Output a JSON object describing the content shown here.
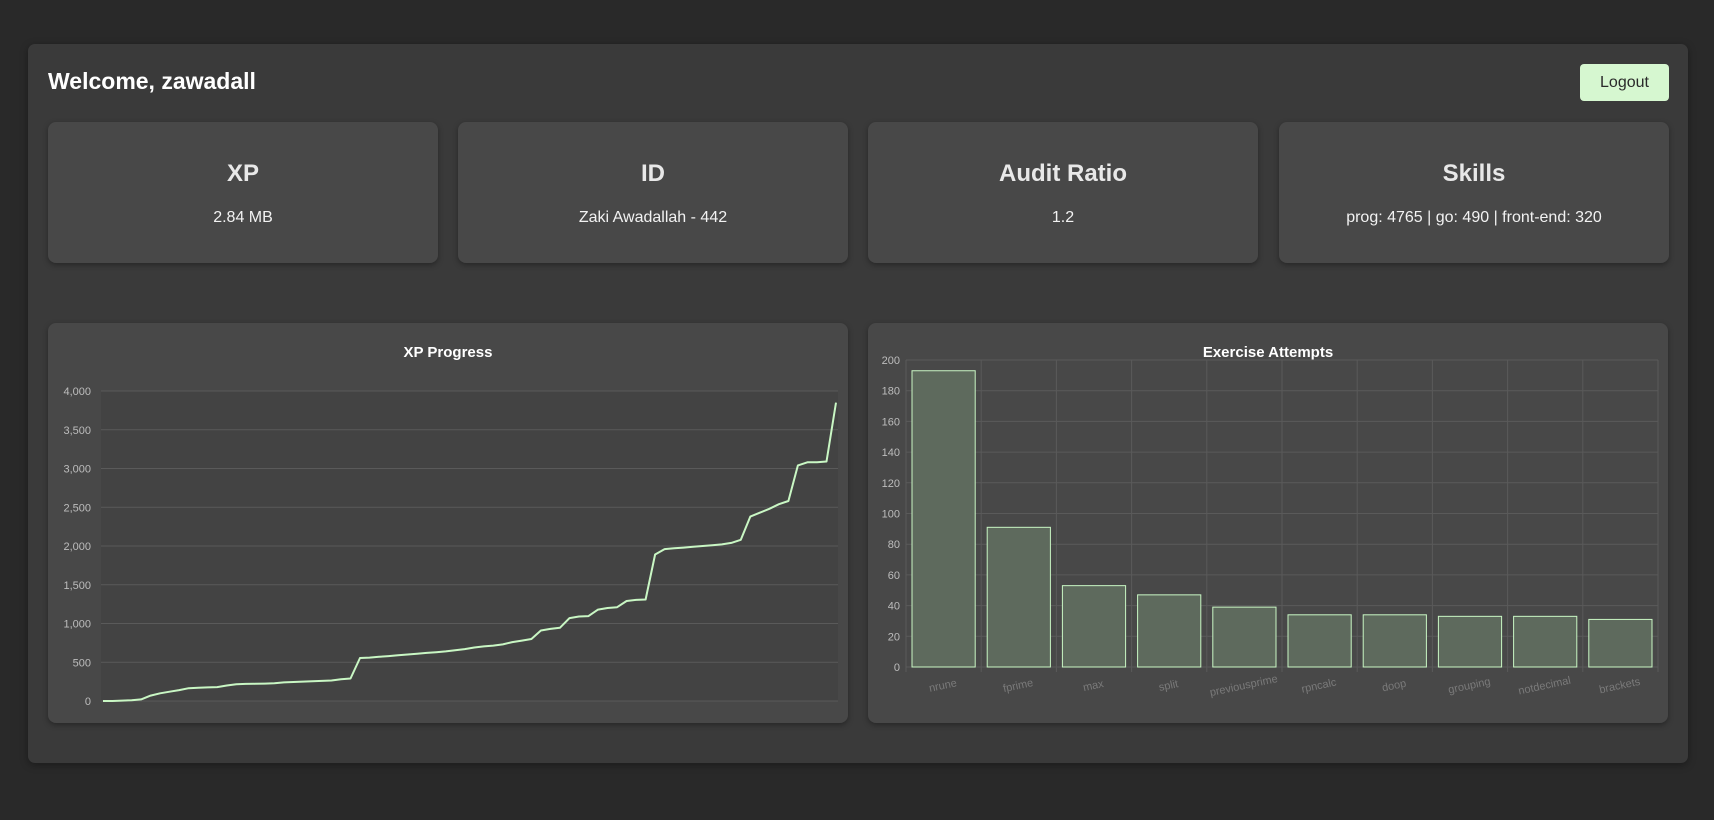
{
  "header": {
    "welcome": "Welcome, zawadall",
    "logout_label": "Logout"
  },
  "stats": [
    {
      "title": "XP",
      "value": "2.84 MB"
    },
    {
      "title": "ID",
      "value": "Zaki Awadallah - 442"
    },
    {
      "title": "Audit Ratio",
      "value": "1.2"
    },
    {
      "title": "Skills",
      "value": "prog: 4765 | go: 490 | front-end: 320"
    }
  ],
  "colors": {
    "accent": "#c9f7c4",
    "bar_fill": "#5e6a5d",
    "grid": "#5a5a5a",
    "tick": "#bdbdbd"
  },
  "chart_data": [
    {
      "type": "line",
      "title": "XP Progress",
      "xlabel": "",
      "ylabel": "",
      "ylim": [
        0,
        4000
      ],
      "yticks": [
        "0",
        "500",
        "1,000",
        "1,500",
        "2,000",
        "2,500",
        "3,000",
        "3,500",
        "4,000"
      ],
      "grid": true,
      "series": [
        {
          "values": [
            0,
            0,
            5,
            10,
            20,
            70,
            100,
            120,
            140,
            165,
            170,
            175,
            180,
            200,
            215,
            220,
            222,
            225,
            230,
            240,
            245,
            250,
            255,
            260,
            265,
            280,
            290,
            555,
            560,
            570,
            580,
            590,
            600,
            610,
            620,
            630,
            640,
            655,
            670,
            690,
            705,
            715,
            730,
            760,
            780,
            800,
            910,
            930,
            945,
            1070,
            1090,
            1095,
            1180,
            1200,
            1210,
            1290,
            1305,
            1310,
            1890,
            1960,
            1970,
            1980,
            1990,
            2000,
            2010,
            2020,
            2040,
            2080,
            2380,
            2430,
            2480,
            2540,
            2580,
            3040,
            3080,
            3080,
            3090,
            3850
          ]
        }
      ]
    },
    {
      "type": "bar",
      "title": "Exercise Attempts",
      "categories": [
        "nrune",
        "fprime",
        "max",
        "split",
        "previousprime",
        "rpncalc",
        "doop",
        "grouping",
        "notdecimal",
        "brackets"
      ],
      "values": [
        193,
        91,
        53,
        47,
        39,
        34,
        34,
        33,
        33,
        31
      ],
      "ylim": [
        0,
        200
      ],
      "yticks": [
        "0",
        "20",
        "40",
        "60",
        "80",
        "100",
        "120",
        "140",
        "160",
        "180",
        "200"
      ],
      "grid": true
    }
  ]
}
